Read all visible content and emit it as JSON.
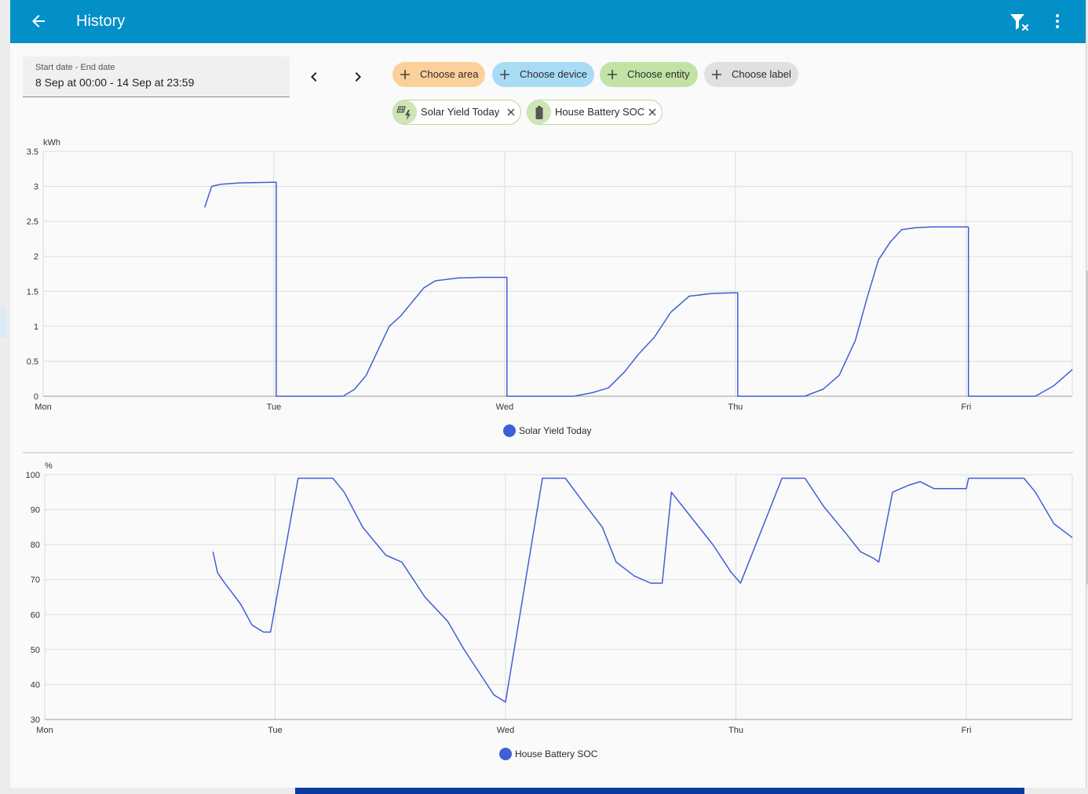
{
  "header": {
    "title": "History",
    "back_icon": "arrow-left-icon",
    "filter_icon": "filter-remove-icon",
    "menu_icon": "dots-vertical-icon",
    "color": "#038fc7"
  },
  "date_range": {
    "label": "Start date - End date",
    "value": "8 Sep at 00:00 - 14 Sep at 23:59"
  },
  "target_chips": [
    {
      "label": "Choose area",
      "color": "#fcd09a"
    },
    {
      "label": "Choose device",
      "color": "#a8dcf5"
    },
    {
      "label": "Choose entity",
      "color": "#c3e3a6"
    },
    {
      "label": "Choose label",
      "color": "#e0e0e0"
    }
  ],
  "selected_entities": [
    {
      "label": "Solar Yield Today",
      "icon": "solar-power-icon"
    },
    {
      "label": "House Battery SOC",
      "icon": "battery-icon"
    }
  ],
  "chart_data": [
    {
      "type": "line",
      "unit": "kWh",
      "x_ticks": [
        "Mon",
        "Tue",
        "Wed",
        "Thu",
        "Fri"
      ],
      "xlim": [
        0,
        4.46
      ],
      "ylim": [
        0,
        3.5
      ],
      "y_ticks": [
        "0",
        "0.5",
        "1",
        "1.5",
        "2",
        "2.5",
        "3",
        "3.5"
      ],
      "grid": true,
      "legend_position": "bottom-center",
      "series": [
        {
          "name": "Solar Yield Today",
          "color": "#3f5fd6",
          "x": [
            0.7,
            0.73,
            0.77,
            0.85,
            1.0,
            1.01,
            1.01,
            1.1,
            1.3,
            1.35,
            1.4,
            1.45,
            1.5,
            1.55,
            1.6,
            1.65,
            1.7,
            1.8,
            1.9,
            2.0,
            2.01,
            2.01,
            2.15,
            2.3,
            2.38,
            2.45,
            2.52,
            2.58,
            2.65,
            2.72,
            2.8,
            2.9,
            3.0,
            3.01,
            3.01,
            3.1,
            3.3,
            3.38,
            3.45,
            3.52,
            3.57,
            3.62,
            3.67,
            3.72,
            3.78,
            3.85,
            4.0,
            4.01,
            4.01,
            4.2,
            4.3,
            4.38,
            4.46
          ],
          "values": [
            2.7,
            3.0,
            3.03,
            3.05,
            3.06,
            3.06,
            0.0,
            0.0,
            0.0,
            0.1,
            0.3,
            0.65,
            1.0,
            1.15,
            1.35,
            1.55,
            1.65,
            1.69,
            1.7,
            1.7,
            1.7,
            0.0,
            0.0,
            0.0,
            0.05,
            0.12,
            0.35,
            0.6,
            0.85,
            1.2,
            1.43,
            1.47,
            1.48,
            1.48,
            0.0,
            0.0,
            0.0,
            0.1,
            0.3,
            0.8,
            1.4,
            1.95,
            2.2,
            2.38,
            2.41,
            2.42,
            2.42,
            2.42,
            0.0,
            0.0,
            0.0,
            0.15,
            0.38
          ]
        }
      ]
    },
    {
      "type": "line",
      "unit": "%",
      "x_ticks": [
        "Mon",
        "Tue",
        "Wed",
        "Thu",
        "Fri"
      ],
      "xlim": [
        0,
        4.46
      ],
      "ylim": [
        30,
        100
      ],
      "y_ticks": [
        "30",
        "40",
        "50",
        "60",
        "70",
        "80",
        "90",
        "100"
      ],
      "grid": true,
      "legend_position": "bottom-center",
      "series": [
        {
          "name": "House Battery SOC",
          "color": "#3f5fd6",
          "x": [
            0.73,
            0.75,
            0.77,
            0.85,
            0.9,
            0.95,
            0.98,
            1.1,
            1.25,
            1.3,
            1.38,
            1.48,
            1.55,
            1.65,
            1.75,
            1.82,
            1.9,
            1.95,
            2.0,
            2.16,
            2.26,
            2.35,
            2.42,
            2.48,
            2.56,
            2.63,
            2.68,
            2.72,
            2.84,
            2.9,
            2.98,
            3.02,
            3.2,
            3.3,
            3.38,
            3.48,
            3.54,
            3.6,
            3.62,
            3.68,
            3.75,
            3.8,
            3.86,
            3.9,
            4.0,
            4.01,
            4.25,
            4.3,
            4.38,
            4.46
          ],
          "values": [
            78,
            72,
            70,
            63,
            57,
            55,
            55,
            99,
            99,
            95,
            85,
            77,
            75,
            65,
            58,
            50,
            42,
            37,
            35,
            99,
            99,
            91,
            85,
            75,
            71,
            69,
            69,
            95,
            85,
            80,
            72,
            69,
            99,
            99,
            91,
            83,
            78,
            76,
            75,
            95,
            97,
            98,
            96,
            96,
            96,
            99,
            99,
            95,
            86,
            82
          ]
        }
      ]
    }
  ]
}
